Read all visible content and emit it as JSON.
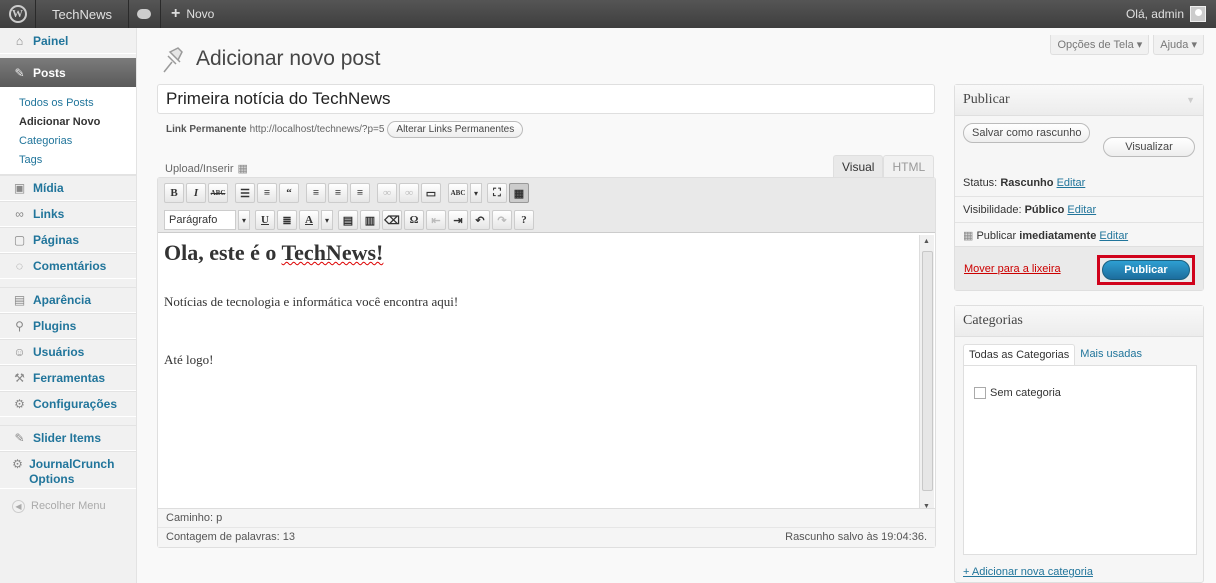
{
  "adminbar": {
    "site_name": "TechNews",
    "new_label": "Novo",
    "greeting": "Olá, admin"
  },
  "sidebar": {
    "painel": "Painel",
    "posts": "Posts",
    "submenu": [
      "Todos os Posts",
      "Adicionar Novo",
      "Categorias",
      "Tags"
    ],
    "midia": "Mídia",
    "links": "Links",
    "paginas": "Páginas",
    "comentarios": "Comentários",
    "aparencia": "Aparência",
    "plugins": "Plugins",
    "usuarios": "Usuários",
    "ferramentas": "Ferramentas",
    "configuracoes": "Configurações",
    "slider_items": "Slider Items",
    "journalcrunch": "JournalCrunch Options",
    "recolher": "Recolher Menu"
  },
  "screen_options": {
    "opcoes": "Opções de Tela ▾",
    "ajuda": "Ajuda ▾"
  },
  "page_title": "Adicionar novo post",
  "post": {
    "title": "Primeira notícia do TechNews",
    "permalink_label": "Link Permanente",
    "permalink_url": "http://localhost/technews/?p=5",
    "permalink_button": "Alterar Links Permanentes"
  },
  "editor": {
    "upload_label": "Upload/Inserir",
    "tab_visual": "Visual",
    "tab_html": "HTML",
    "format_select": "Parágrafo",
    "heading_prefix": "Ola, este é o ",
    "heading_spell": "TechNews!",
    "paragraph1": "Notícias de tecnologia e informática você encontra aqui!",
    "paragraph2": "Até logo!",
    "path": "Caminho: p",
    "word_count": "Contagem de palavras: 13",
    "draft_saved": "Rascunho salvo às 19:04:36."
  },
  "publish_box": {
    "title": "Publicar",
    "save_draft": "Salvar como rascunho",
    "preview": "Visualizar",
    "status_label": "Status:",
    "status_value": "Rascunho",
    "visibility_label": "Visibilidade:",
    "visibility_value": "Público",
    "publish_label": "Publicar",
    "publish_value": "imediatamente",
    "edit": "Editar",
    "trash": "Mover para a lixeira",
    "publish_button": "Publicar"
  },
  "categories_box": {
    "title": "Categorias",
    "tab_all": "Todas as Categorias",
    "tab_most_used": "Mais usadas",
    "items": [
      "Sem categoria"
    ],
    "add_new": "+ Adicionar nova categoria"
  },
  "colors": {
    "link": "#21759b",
    "primary": "#2583c0",
    "highlight": "#d0021b"
  }
}
